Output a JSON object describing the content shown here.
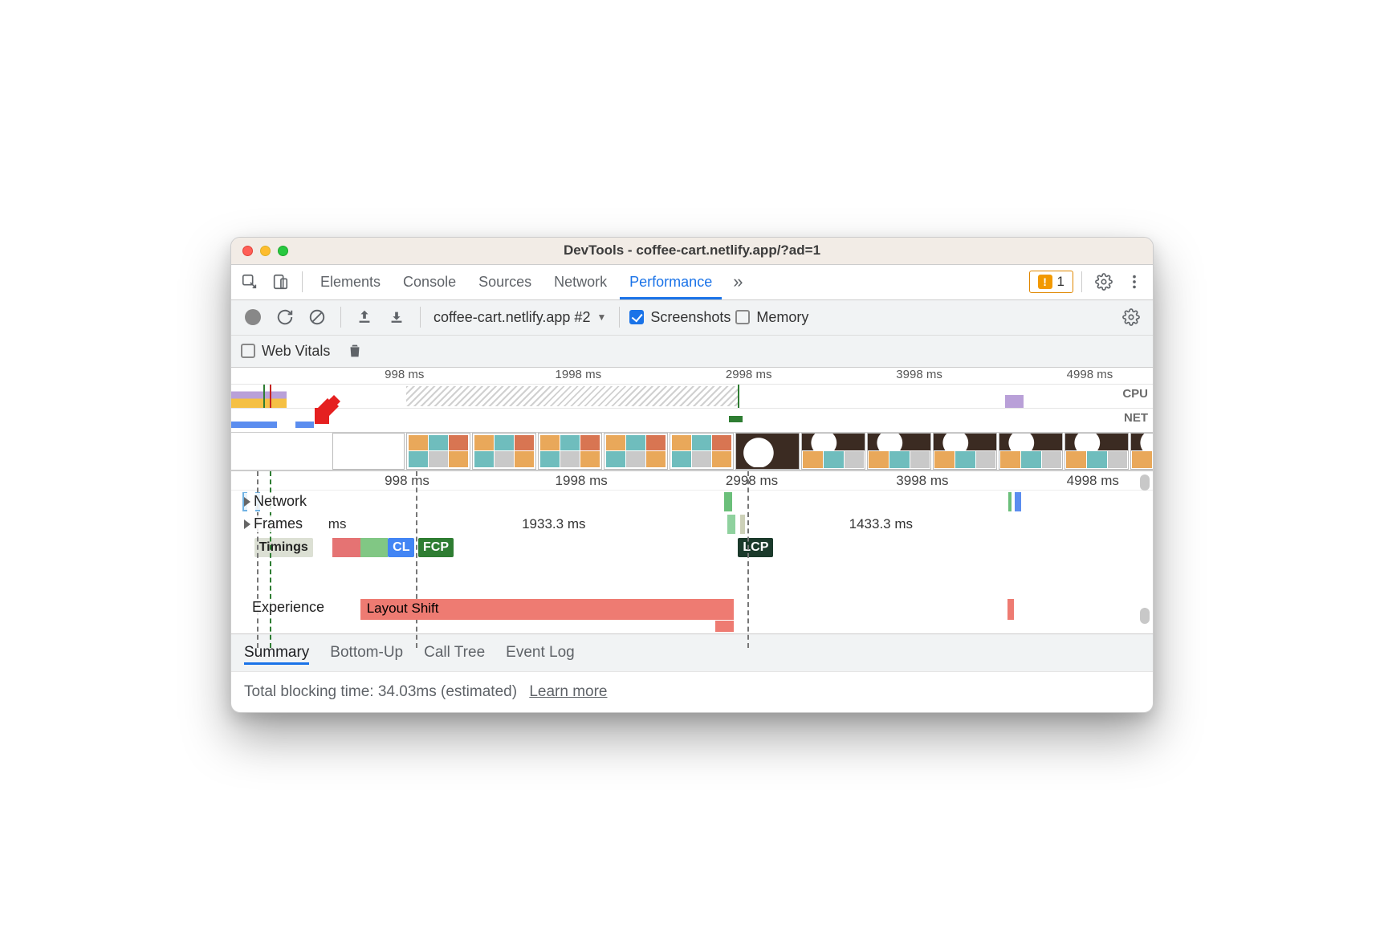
{
  "window": {
    "title": "DevTools - coffee-cart.netlify.app/?ad=1"
  },
  "tabs": {
    "items": [
      "Elements",
      "Console",
      "Sources",
      "Network",
      "Performance"
    ],
    "active": "Performance",
    "warn_count": "1"
  },
  "toolbar": {
    "profile_label": "coffee-cart.netlify.app #2",
    "screenshots": {
      "label": "Screenshots",
      "checked": true
    },
    "memory": {
      "label": "Memory",
      "checked": false
    }
  },
  "toolbar2": {
    "web_vitals_label": "Web Vitals"
  },
  "overview": {
    "ticks": [
      "998 ms",
      "1998 ms",
      "2998 ms",
      "3998 ms",
      "4998 ms"
    ],
    "cpu_label": "CPU",
    "net_label": "NET"
  },
  "main_ruler": {
    "ticks": [
      "998 ms",
      "1998 ms",
      "2998 ms",
      "3998 ms",
      "4998 ms"
    ]
  },
  "tracks": {
    "network": "Network",
    "frames": "Frames",
    "frame_segments": [
      {
        "label": "ms",
        "left": "10%",
        "width": "5.5%"
      },
      {
        "label": "1933.3 ms",
        "left": "16%",
        "width": "38%"
      },
      {
        "label": "1433.3 ms",
        "left": "57%",
        "width": "27%"
      }
    ],
    "timings_label": "Timings",
    "pills": {
      "cl": {
        "text": "CL",
        "left": "17%",
        "bg": "#4285f4"
      },
      "fcp": {
        "text": "FCP",
        "left": "20.3%",
        "bg": "#2e7d32"
      },
      "lcp": {
        "text": "LCP",
        "left": "55%",
        "bg": "#1b3a2b"
      }
    },
    "experience": "Experience",
    "layout_shift": "Layout Shift"
  },
  "bottom_tabs": {
    "items": [
      "Summary",
      "Bottom-Up",
      "Call Tree",
      "Event Log"
    ],
    "active": "Summary"
  },
  "summary": {
    "tbt": "Total blocking time: 34.03ms (estimated)",
    "learn_more": "Learn more"
  }
}
